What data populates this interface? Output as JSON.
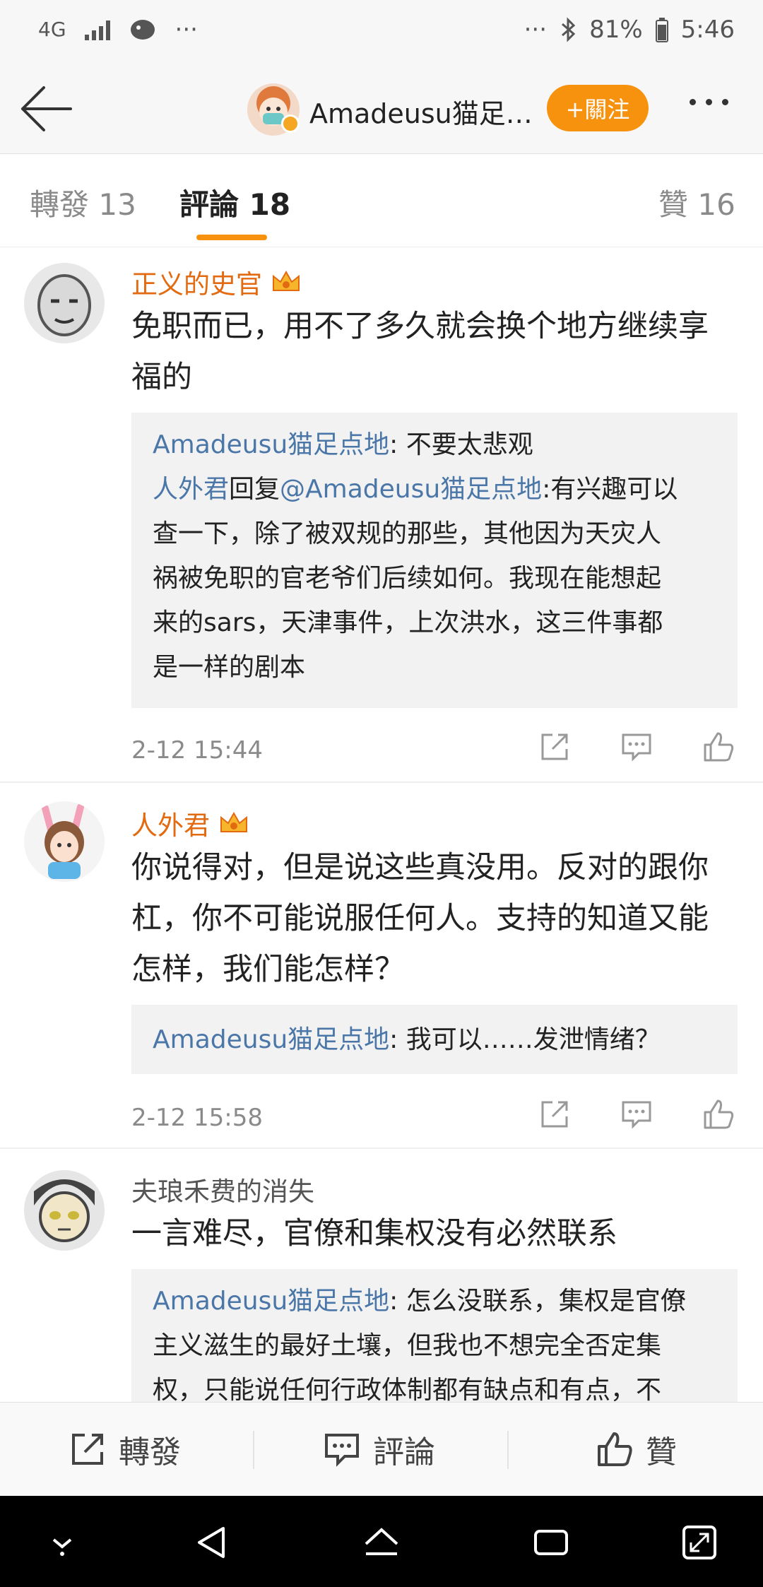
{
  "status_bar": {
    "network": "4G",
    "more_left": "···",
    "more_right": "···",
    "battery_percent": "81%",
    "time": "5:46"
  },
  "header": {
    "username": "Amadeusu猫足…",
    "follow_label": "+關注"
  },
  "tabs": [
    {
      "label": "轉發 13"
    },
    {
      "label": "評論 18"
    },
    {
      "label": "贊 16"
    }
  ],
  "active_tab_index": 1,
  "comments": [
    {
      "username": "正义的史官",
      "vip": true,
      "text_lines": [
        "免职而已，用不了多久就会换个地方继续享",
        "福的"
      ],
      "replies": [
        {
          "name": "Amadeusu猫足点地",
          "text": ": 不要太悲观"
        },
        {
          "name": "人外君",
          "mid": "回复",
          "mention": "@Amadeusu猫足点地",
          "lines": [
            ":有兴趣可以",
            "查一下，除了被双规的那些，其他因为天灾人",
            "祸被免职的官老爷们后续如何。我现在能想起",
            "来的sars，天津事件，上次洪水，这三件事都",
            "是一样的剧本"
          ]
        }
      ],
      "time": "2-12 15:44"
    },
    {
      "username": "人外君",
      "vip": true,
      "text_lines": [
        "你说得对，但是说这些真没用。反对的跟你",
        "杠，你不可能说服任何人。支持的知道又能",
        "怎样，我们能怎样？"
      ],
      "replies": [
        {
          "name": "Amadeusu猫足点地",
          "text": ": 我可以……发泄情绪？"
        }
      ],
      "time": "2-12 15:58"
    },
    {
      "username": "夫琅禾费的消失",
      "vip": false,
      "text_lines": [
        "一言难尽，官僚和集权没有必然联系"
      ],
      "replies": [
        {
          "name": "Amadeusu猫足点地",
          "lines": [
            ": 怎么没联系，集权是官僚",
            "主义滋生的最好土壤，但我也不想完全否定集",
            "权，只能说任何行政体制都有缺点和有点，不"
          ]
        }
      ]
    }
  ],
  "bottom_bar": {
    "repost_label": "轉發",
    "comment_label": "評論",
    "like_label": "贊"
  },
  "colors": {
    "accent_orange": "#f7920f",
    "vip_name": "#e26a11",
    "reply_name": "#4a76a8"
  },
  "icons": [
    "back-arrow-icon",
    "more-dots-icon",
    "share-icon",
    "comment-icon",
    "thumbs-up-icon",
    "crown-icon",
    "verified-icon"
  ]
}
